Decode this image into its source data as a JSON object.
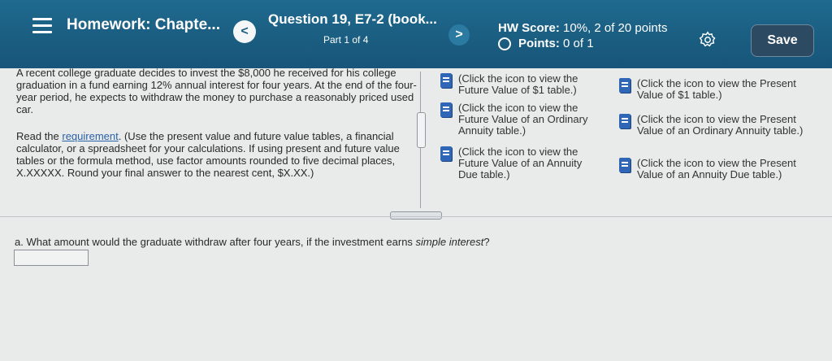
{
  "header": {
    "homework_title": "Homework: Chapte...",
    "prev_label": "<",
    "question_title": "Question 19, E7-2 (book...",
    "part": "Part 1 of 4",
    "next_label": ">",
    "score_label": "HW Score:",
    "score_value": "10%, 2 of 20 points",
    "points_label": "Points:",
    "points_value": "0 of 1",
    "save_label": "Save"
  },
  "problem": {
    "paragraph1": "A recent college graduate decides to invest the $8,000 he received for his college graduation in a fund earning 12% annual interest for four years. At the end of the four-year period, he expects to withdraw the money to purchase a reasonably priced used car.",
    "read_the": "Read the ",
    "requirement_link": "requirement",
    "paragraph2_rest": ". (Use the present value and future value tables, a financial calculator, or a spreadsheet for your calculations. If using present and future value tables or the formula method, use factor amounts rounded to five decimal places, X.XXXXX. Round your final answer to the nearest cent, $X.XX.)"
  },
  "table_links": [
    {
      "text": "(Click the icon to view the Future Value of $1 table.)",
      "icon": "book-icon"
    },
    {
      "text": "(Click the icon to view the Present Value of $1 table.)",
      "icon": "book-icon"
    },
    {
      "text": "(Click the icon to view the Future Value of an Ordinary Annuity table.)",
      "icon": "book-icon"
    },
    {
      "text": "(Click the icon to view the Present Value of an Ordinary Annuity table.)",
      "icon": "book-icon"
    },
    {
      "text": "(Click the icon to view the Future Value of an Annuity Due table.)",
      "icon": "book-icon"
    },
    {
      "text": "(Click the icon to view the Present Value of an Annuity Due table.)",
      "icon": "book-icon"
    }
  ],
  "question_a": {
    "prefix": "a. What amount would the graduate withdraw after four years, if the investment earns ",
    "emphasis": "simple interest",
    "suffix": "?",
    "answer_value": ""
  },
  "colors": {
    "header_bg": "#1a5d80",
    "save_bg": "#2c4a61",
    "link": "#2a62a8",
    "book_icon": "#2f66b5"
  }
}
